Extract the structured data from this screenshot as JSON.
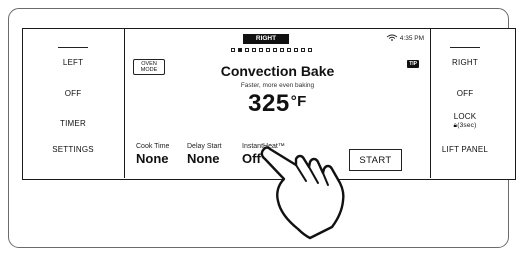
{
  "left_controls": {
    "buttons": [
      "LEFT",
      "OFF",
      "TIMER",
      "SETTINGS"
    ]
  },
  "right_controls": {
    "right": "RIGHT",
    "off": "OFF",
    "lock": "LOCK",
    "lock_sub": "(3sec)",
    "lift_panel": "LIFT PANEL"
  },
  "display": {
    "zone": "RIGHT",
    "time": "4:35 PM",
    "status_icons": [
      "wifi-icon"
    ],
    "page_indicator": {
      "total": 12,
      "active": 1
    },
    "oven_mode_tag": "OVEN MODE",
    "tip_tag": "TIP",
    "mode": "Convection Bake",
    "mode_description": "Faster, more even baking",
    "temperature": "325",
    "temperature_unit": "°F",
    "options": [
      {
        "label": "Cook Time",
        "value": "None"
      },
      {
        "label": "Delay Start",
        "value": "None"
      },
      {
        "label": "InstantHeat™",
        "value": "Off"
      }
    ],
    "start_label": "START"
  }
}
